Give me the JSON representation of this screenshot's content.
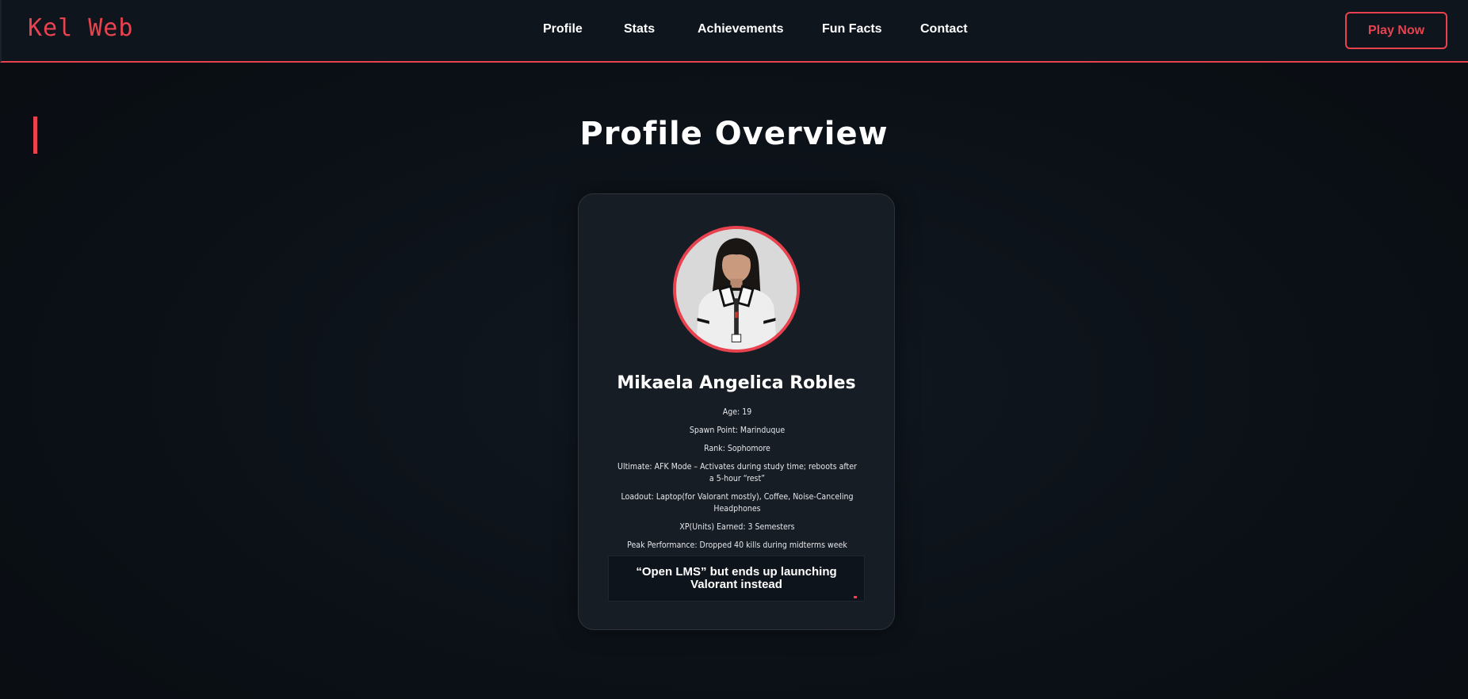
{
  "brand": "Kel Web",
  "nav": {
    "links": [
      "Profile",
      "Stats",
      "Achievements",
      "Fun Facts",
      "Contact"
    ],
    "cta": "Play Now"
  },
  "profile": {
    "section_title": "Profile Overview",
    "name": "Mikaela Angelica Robles",
    "details": [
      "Age: 19",
      "Spawn Point: Marinduque",
      "Rank: Sophomore",
      "Ultimate: AFK Mode – Activates during study time; reboots after a 5-hour “rest”",
      "Loadout: Laptop(for Valorant mostly), Coffee, Noise-Canceling Headphones",
      "XP(Units) Earned: 3 Semesters",
      "Peak Performance: Dropped 40 kills during midterms week"
    ],
    "quote": "“Open LMS” but ends up launching Valorant instead"
  },
  "colors": {
    "accent": "#e8424f",
    "background": "#0b1016",
    "card": "#171d24"
  }
}
